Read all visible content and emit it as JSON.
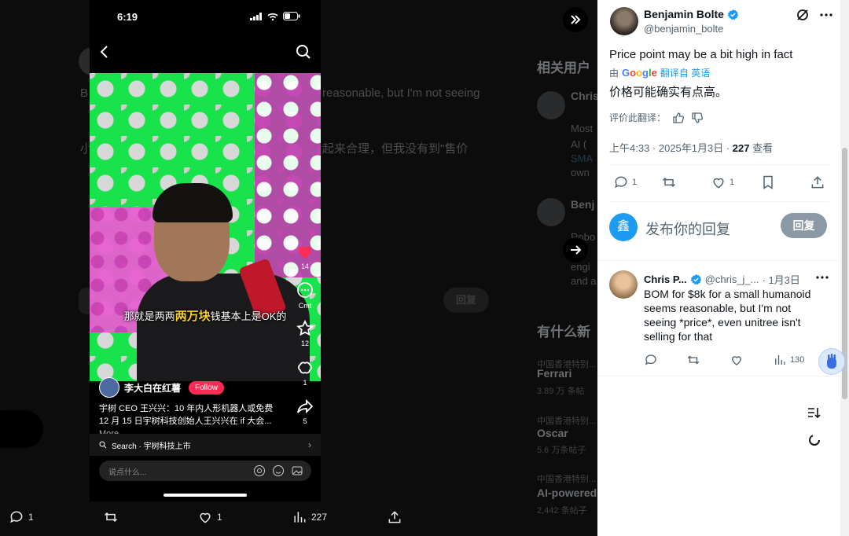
{
  "background": {
    "tweet_text_en_1": "B",
    "tweet_text_en_right": "reasonable, but I'm not seeing",
    "tweet_text_zh_1": "小",
    "tweet_text_zh_right": "起来合理，但我没有到\"售价",
    "side_title_1": "相关用户",
    "side_title_2": "有什么新",
    "user_1_name": "Chris",
    "user_1_lines": [
      "Most",
      "AI (",
      "SMA",
      "own"
    ],
    "user_2_name": "Benj",
    "user_2_lines": [
      "Robo",
      "engi",
      "and a"
    ],
    "trends": [
      {
        "category": "中国香港特别...",
        "title": "Ferrari",
        "count": "3.89 万 条帖"
      },
      {
        "category": "中国香港特别...",
        "title": "Oscar",
        "count": "5.6 万条帖子"
      },
      {
        "category": "中国香港特别...",
        "title": "AI-powered",
        "count": "2,442 条帖子"
      }
    ],
    "reply_label": "回复",
    "bottom_actions": {
      "replies": "1",
      "likes": "1",
      "views": "227"
    }
  },
  "phone": {
    "time": "6:19",
    "subtitle_before": "那就是两两",
    "subtitle_highlight": "两万块",
    "subtitle_after": "钱基本上是OK的",
    "rail": {
      "likes": "14",
      "comments": "Cmt",
      "favorites": "12",
      "shares_alt": "1",
      "shares": "5"
    },
    "creator_name": "李大白在红薯",
    "follow_label": "Follow",
    "caption": "宇树 CEO 王兴兴：10 年内人形机器人或免费 12 月 15 日宇树科技创始人王兴兴在 if 大会...",
    "caption_more": "More",
    "search_label": "Search · 宇树科技上市",
    "comment_placeholder": "说点什么..."
  },
  "tweet": {
    "author_name": "Benjamin Bolte",
    "author_handle": "@benjamin_bolte",
    "text": "Price point may be a bit high in fact",
    "translated_by": "由",
    "google": "Google",
    "translated_from": "翻译自 英语",
    "translation": "价格可能确实有点高。",
    "rate_translation": "评价此翻译：",
    "meta_time": "上午4:33 · 2025年1月3日 · ",
    "meta_views": "227",
    "meta_views_label": " 查看",
    "replies": "1",
    "likes": "1"
  },
  "reply_box": {
    "avatar_letter": "鑫",
    "placeholder": "发布你的回复",
    "button": "回复"
  },
  "comment": {
    "name": "Chris P...",
    "handle": "@chris_j_...",
    "date": "· 1月3日",
    "text": "BOM for $8k for a small humanoid seems reasonable, but I'm not seeing *price*, even unitree isn't selling for that",
    "views": "130"
  },
  "colors": {
    "accent": "#1d9bf0",
    "tiktok_red": "#fe2c55",
    "reply_button": "#8b98a5"
  }
}
